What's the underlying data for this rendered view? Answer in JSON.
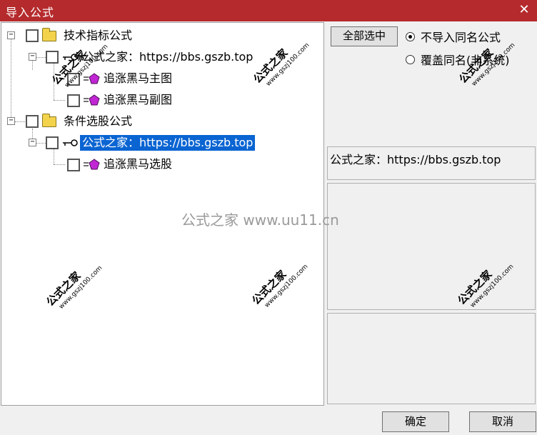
{
  "window": {
    "title": "导入公式",
    "close_glyph": "✕"
  },
  "tree": {
    "nodes": [
      {
        "label": "技术指标公式",
        "type": "folder"
      },
      {
        "label": "公式之家：https://bbs.gszb.top",
        "type": "key"
      },
      {
        "label": "追涨黑马主图",
        "type": "formula"
      },
      {
        "label": "追涨黑马副图",
        "type": "formula"
      },
      {
        "label": "条件选股公式",
        "type": "folder"
      },
      {
        "label": "公式之家：https://bbs.gszb.top",
        "type": "key",
        "selected": true
      },
      {
        "label": "追涨黑马选股",
        "type": "formula"
      }
    ]
  },
  "actions": {
    "select_all": "全部选中",
    "radio_no_import": "不导入同名公式",
    "radio_overwrite": "覆盖同名(非系统)",
    "selected_option": "不导入同名公式"
  },
  "info": {
    "description": "公式之家：https://bbs.gszb.top"
  },
  "watermarks": {
    "center": "公式之家 www.uu11.cn",
    "stamp_text": "公式之家",
    "stamp_url": "www.gszj100.com"
  },
  "footer": {
    "ok": "确定",
    "cancel": "取消"
  },
  "colors": {
    "titlebar": "#b52a2c",
    "selection": "#0a64d2",
    "folder": "#f4d34c",
    "gem": "#c026d3"
  }
}
